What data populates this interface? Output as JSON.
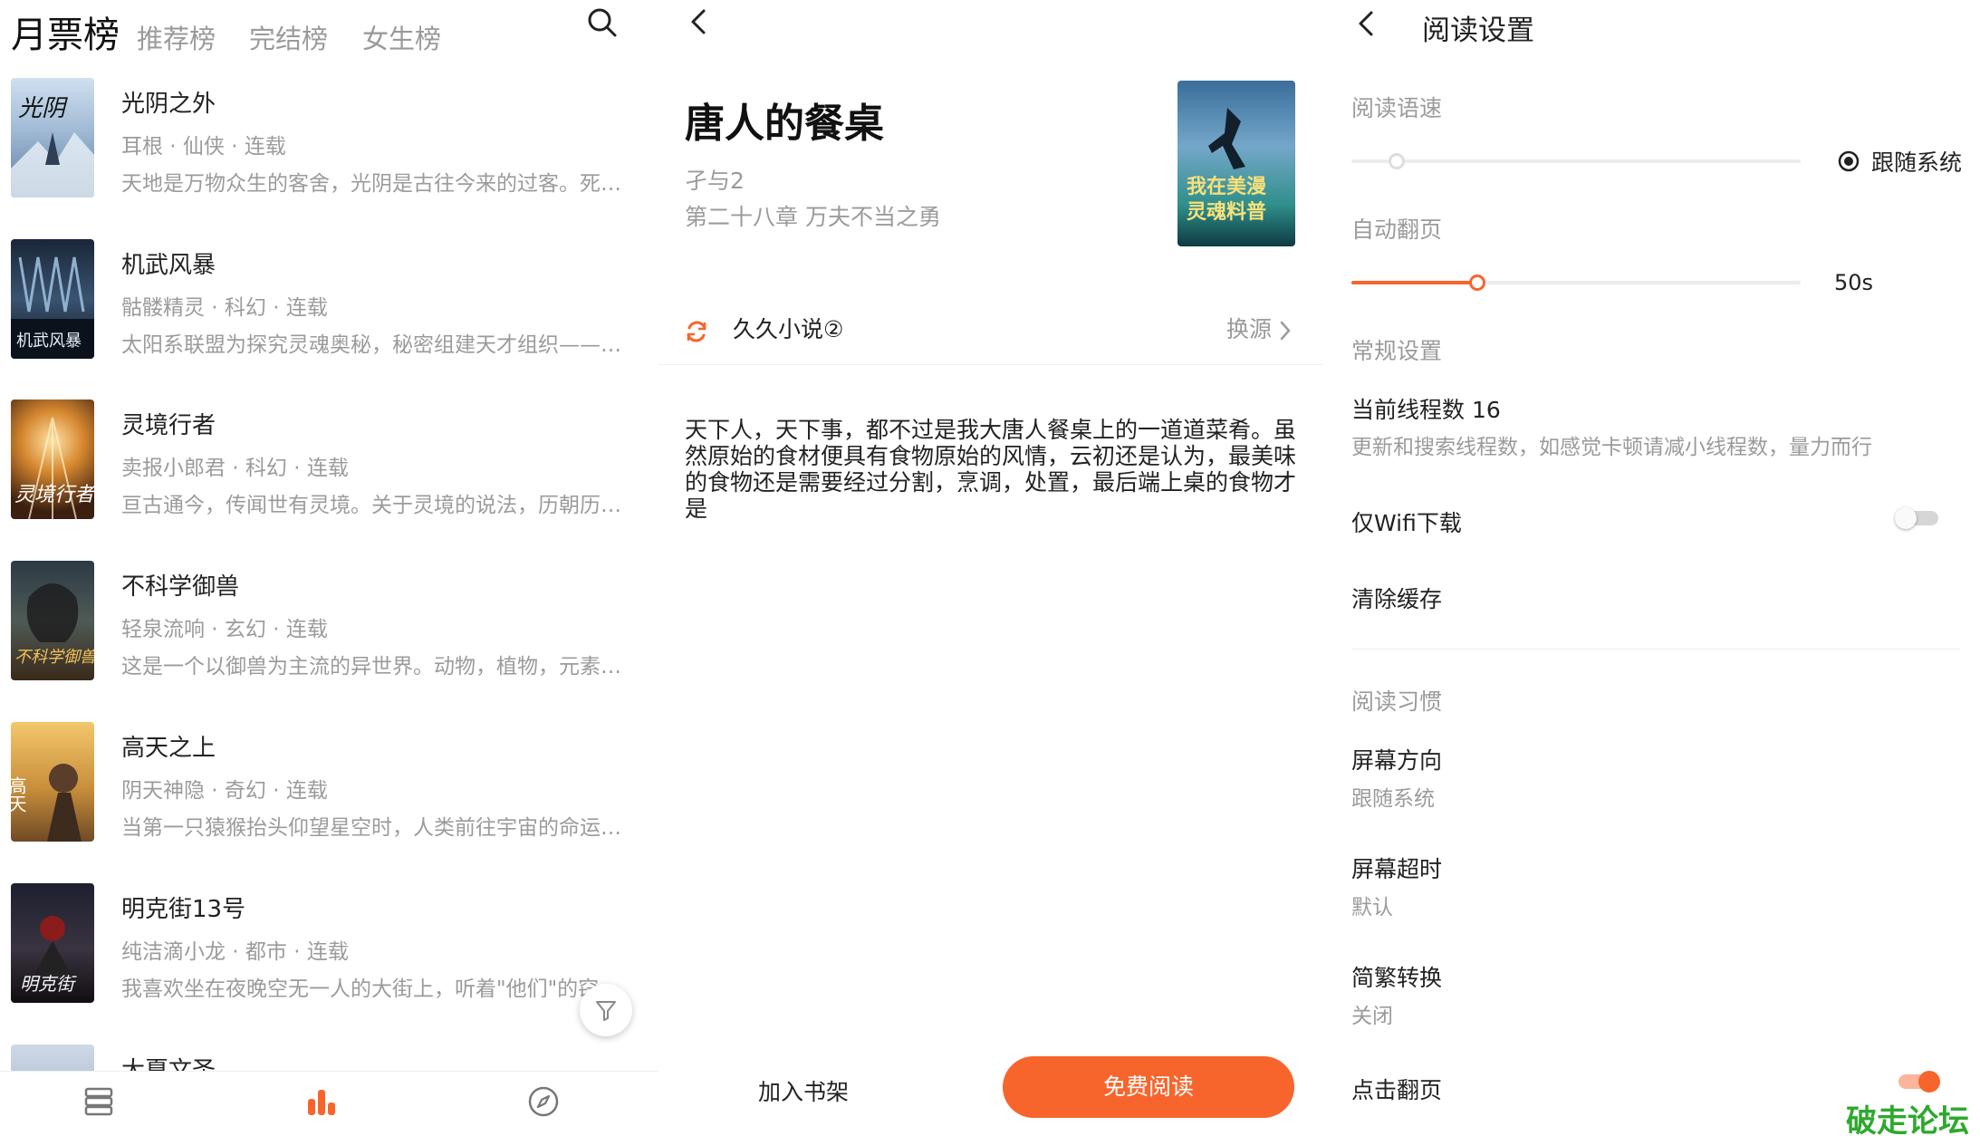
{
  "colors": {
    "accent": "#f7652c",
    "text": "#222222",
    "muted": "#9b9b9b",
    "watermark": "#2ea82f"
  },
  "rank": {
    "tabs": [
      "月票榜",
      "推荐榜",
      "完结榜",
      "女生榜"
    ],
    "books": [
      {
        "title": "光阴之外",
        "meta": "耳根 · 仙侠 · 连载",
        "desc": "天地是万物众生的客舍，光阴是古往今来的过客。死生..."
      },
      {
        "title": "机武风暴",
        "meta": "骷髅精灵 · 科幻 · 连载",
        "desc": "太阳系联盟为探究灵魂奥秘，秘密组建天才组织——天..."
      },
      {
        "title": "灵境行者",
        "meta": "卖报小郎君 · 科幻 · 连载",
        "desc": "亘古通今，传闻世有灵境。关于灵境的说法，历朝历代..."
      },
      {
        "title": "不科学御兽",
        "meta": "轻泉流响 · 玄幻 · 连载",
        "desc": "这是一个以御兽为主流的异世界。动物，植物，元素，..."
      },
      {
        "title": "高天之上",
        "meta": "阴天神隐 · 奇幻 · 连载",
        "desc": "当第一只猿猴抬头仰望星空时，人类前往宇宙的命运就..."
      },
      {
        "title": "明克街13号",
        "meta": "纯洁滴小龙 · 都市 · 连载",
        "desc": "我喜欢坐在夜晚空无一人的大街上，听着\"他们\"的窃窃..."
      },
      {
        "title": "大夏文圣",
        "meta": "",
        "desc": ""
      }
    ]
  },
  "detail": {
    "title": "唐人的餐桌",
    "author": "孑与2",
    "chapter": "第二十八章 万夫不当之勇",
    "cover_text": "我在美漫灵魂料普",
    "source": "久久小说②",
    "change_source": "换源",
    "synopsis": "天下人，天下事，都不过是我大唐人餐桌上的一道道菜肴。虽然原始的食材便具有食物原始的风情，云初还是认为，最美味的食物还是需要经过分割，烹调，处置，最后端上桌的食物才是",
    "add_shelf": "加入书架",
    "read_free": "免费阅读"
  },
  "settings": {
    "title": "阅读设置",
    "speech_rate_label": "阅读语速",
    "speech_rate_value": 0.1,
    "follow_system": "跟随系统",
    "auto_page_label": "自动翻页",
    "auto_page_fraction": 0.28,
    "auto_page_value": "50s",
    "general_label": "常规设置",
    "threads_title": "当前线程数 16",
    "threads_desc": "更新和搜索线程数，如感觉卡顿请减小线程数，量力而行",
    "wifi_only": "仅Wifi下载",
    "wifi_only_on": false,
    "clear_cache": "清除缓存",
    "habits_label": "阅读习惯",
    "orientation_title": "屏幕方向",
    "orientation_value": "跟随系统",
    "timeout_title": "屏幕超时",
    "timeout_value": "默认",
    "convert_title": "简繁转换",
    "convert_value": "关闭",
    "tap_page_title": "点击翻页",
    "tap_page_on": true
  },
  "watermark": "破走论坛"
}
